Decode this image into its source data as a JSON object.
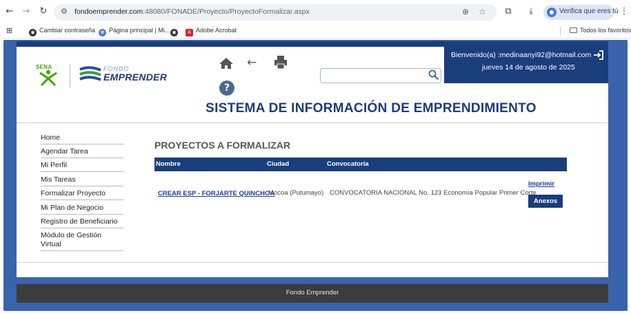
{
  "browser": {
    "url_host": "fondoemprender.com",
    "url_path": ":48080/FONADE/Proyecto/ProyectoFormalizar.aspx",
    "profile_label": "Verifica que eres tú",
    "bookmarks": [
      {
        "label": "Cambiar contraseña",
        "icon": "globe-icon"
      },
      {
        "label": "Página principal | Mi...",
        "icon": "gear-icon"
      },
      {
        "label": "",
        "icon": "globe-icon"
      },
      {
        "label": "Adobe Acrobat",
        "icon": "pdf-icon"
      }
    ],
    "all_bookmarks_label": "Todos los favoritos"
  },
  "header": {
    "sena_text": "SENA",
    "brand_top": "FONDO",
    "brand_bottom": "EMPRENDER",
    "welcome": "Bienvenido(a) :medinaanyi92@hotmail.com",
    "date": "jueves 14 de agosto de 2025",
    "system_title": "SISTEMA DE INFORMACIÓN DE EMPRENDIMIENTO",
    "search_value": "",
    "colors": {
      "primary": "#1a3d7c",
      "frame": "#3a63ad",
      "sena_green": "#39a900"
    }
  },
  "sidebar": {
    "items": [
      {
        "label": "Home"
      },
      {
        "label": "Agendar Tarea"
      },
      {
        "label": "Mi Perfil"
      },
      {
        "label": "Mis Tareas"
      },
      {
        "label": "Formalizar Proyecto"
      },
      {
        "label": "Mi Plan de Negocio"
      },
      {
        "label": "Registro de Beneficiario"
      },
      {
        "label": "Módulo de Gestión Virtual"
      }
    ]
  },
  "main": {
    "section_title": "PROYECTOS A FORMALIZAR",
    "columns": [
      "Nombre",
      "Ciudad",
      "Convocatoria"
    ],
    "rows": [
      {
        "nombre": "CREAR ESP - FORJARTE QUINCHOA",
        "ciudad": "Mocoa (Putumayo)",
        "convocatoria": "CONVOCATORIA NACIONAL No. 123 Economía Popular Primer Corte",
        "print_label": "Imprimir",
        "annex_label": "Anexos"
      }
    ]
  },
  "footer": {
    "text": "Fondo Emprender"
  }
}
